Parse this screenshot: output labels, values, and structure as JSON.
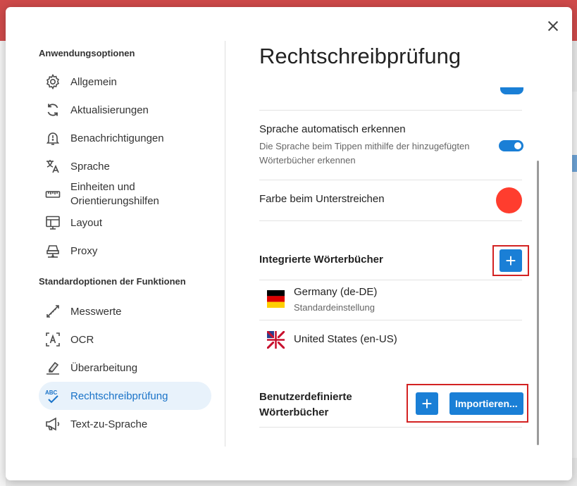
{
  "colors": {
    "accent": "#1a7fd6",
    "highlight": "#d32222",
    "underline_color": "#ff3d2e",
    "active_bg": "#e8f2fb"
  },
  "nav": {
    "section_app": "Anwendungsoptionen",
    "section_features": "Standardoptionen der Funktionen",
    "app_items": [
      {
        "label": "Allgemein",
        "icon": "gear-icon"
      },
      {
        "label": "Aktualisierungen",
        "icon": "refresh-icon"
      },
      {
        "label": "Benachrichtigungen",
        "icon": "bell-alert-icon"
      },
      {
        "label": "Sprache",
        "icon": "translate-icon"
      },
      {
        "label_line1": "Einheiten und",
        "label_line2": "Orientierungshilfen",
        "icon": "ruler-icon"
      },
      {
        "label": "Layout",
        "icon": "layout-icon"
      },
      {
        "label": "Proxy",
        "icon": "network-icon"
      }
    ],
    "feature_items": [
      {
        "label": "Messwerte",
        "icon": "measure-icon"
      },
      {
        "label": "OCR",
        "icon": "ocr-icon"
      },
      {
        "label": "Überarbeitung",
        "icon": "eraser-icon"
      },
      {
        "label": "Rechtschreibprüfung",
        "icon": "spellcheck-icon",
        "active": true
      },
      {
        "label": "Text-zu-Sprache",
        "icon": "megaphone-icon"
      }
    ]
  },
  "content": {
    "title": "Rechtschreibprüfung",
    "auto_detect": {
      "label": "Sprache automatisch erkennen",
      "desc_line1": "Die Sprache beim Tippen mithilfe der hinzugefügten",
      "desc_line2": "Wörterbücher erkennen",
      "enabled": true
    },
    "underline": {
      "label": "Farbe beim Unterstreichen"
    },
    "builtin": {
      "heading": "Integrierte Wörterbücher",
      "add_label": "+",
      "dictionaries": [
        {
          "name": "Germany (de-DE)",
          "sub": "Standardeinstellung",
          "flag": "de-flag-icon"
        },
        {
          "name": "United States (en-US)",
          "flag": "us-flag-icon"
        }
      ]
    },
    "custom": {
      "heading_line1": "Benutzerdefinierte",
      "heading_line2": "Wörterbücher",
      "add_label": "+",
      "import_label": "Importieren..."
    }
  }
}
